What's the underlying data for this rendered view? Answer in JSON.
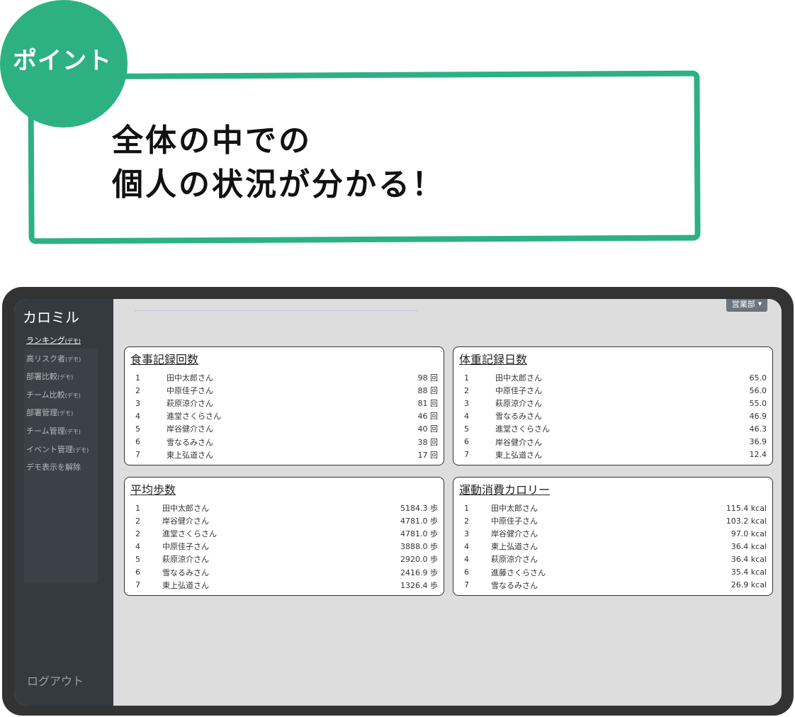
{
  "callout": {
    "badge": "ポイント",
    "line1": "全体の中での",
    "line2": "個人の状況が分かる！"
  },
  "app": {
    "brand": "カロミル",
    "dept_button": "営業部",
    "logout": "ログアウト",
    "nav": [
      {
        "label": "ランキング",
        "tag": "(デモ)",
        "active": true
      },
      {
        "label": "高リスク者",
        "tag": "(デモ)"
      },
      {
        "label": "部署比較",
        "tag": "(デモ)"
      },
      {
        "label": "チーム比較",
        "tag": "(デモ)"
      },
      {
        "label": "部署管理",
        "tag": "(デモ)"
      },
      {
        "label": "チーム管理",
        "tag": "(デモ)"
      },
      {
        "label": "イベント管理",
        "tag": "(デモ)"
      },
      {
        "label": "デモ表示を解除",
        "tag": ""
      }
    ]
  },
  "cards": {
    "meals": {
      "title": "食事記録回数",
      "rows": [
        {
          "rank": "1",
          "name": "田中太郎さん",
          "value": "98 回"
        },
        {
          "rank": "2",
          "name": "中原佳子さん",
          "value": "88 回"
        },
        {
          "rank": "3",
          "name": "萩原涼介さん",
          "value": "81 回"
        },
        {
          "rank": "4",
          "name": "進堂さくらさん",
          "value": "46 回"
        },
        {
          "rank": "5",
          "name": "岸谷健介さん",
          "value": "40 回"
        },
        {
          "rank": "6",
          "name": "雪なるみさん",
          "value": "38 回"
        },
        {
          "rank": "7",
          "name": "東上弘道さん",
          "value": "17 回"
        }
      ]
    },
    "weight": {
      "title": "体重記録日数",
      "rows": [
        {
          "rank": "1",
          "name": "田中太郎さん",
          "value": "65.0"
        },
        {
          "rank": "2",
          "name": "中原佳子さん",
          "value": "56.0"
        },
        {
          "rank": "3",
          "name": "萩原涼介さん",
          "value": "55.0"
        },
        {
          "rank": "4",
          "name": "雪なるみさん",
          "value": "46.9"
        },
        {
          "rank": "5",
          "name": "進堂さくらさん",
          "value": "46.3"
        },
        {
          "rank": "6",
          "name": "岸谷健介さん",
          "value": "36.9"
        },
        {
          "rank": "7",
          "name": "東上弘道さん",
          "value": "12.4"
        }
      ]
    },
    "steps": {
      "title": "平均歩数",
      "rows": [
        {
          "rank": "1",
          "name": "田中太郎さん",
          "value": "5184.3 歩"
        },
        {
          "rank": "2",
          "name": "岸谷健介さん",
          "value": "4781.0 歩"
        },
        {
          "rank": "2",
          "name": "進堂さくらさん",
          "value": "4781.0 歩"
        },
        {
          "rank": "4",
          "name": "中原佳子さん",
          "value": "3888.0 歩"
        },
        {
          "rank": "5",
          "name": "萩原涼介さん",
          "value": "2920.0 歩"
        },
        {
          "rank": "6",
          "name": "雪なるみさん",
          "value": "2416.9 歩"
        },
        {
          "rank": "7",
          "name": "東上弘道さん",
          "value": "1326.4 歩"
        }
      ]
    },
    "calories": {
      "title": "運動消費カロリー",
      "rows": [
        {
          "rank": "1",
          "name": "田中太郎さん",
          "value": "115.4 kcal"
        },
        {
          "rank": "2",
          "name": "中原佳子さん",
          "value": "103.2 kcal"
        },
        {
          "rank": "3",
          "name": "岸谷健介さん",
          "value": "97.0 kcal"
        },
        {
          "rank": "4",
          "name": "東上弘道さん",
          "value": "36.4 kcal"
        },
        {
          "rank": "4",
          "name": "萩原涼介さん",
          "value": "36.4 kcal"
        },
        {
          "rank": "6",
          "name": "進藤さくらさん",
          "value": "35.4 kcal"
        },
        {
          "rank": "7",
          "name": "雪なるみさん",
          "value": "26.9 kcal"
        }
      ]
    }
  },
  "colors": {
    "accent": "#2db182",
    "sidebar": "#343a40",
    "frame": "#333333"
  }
}
